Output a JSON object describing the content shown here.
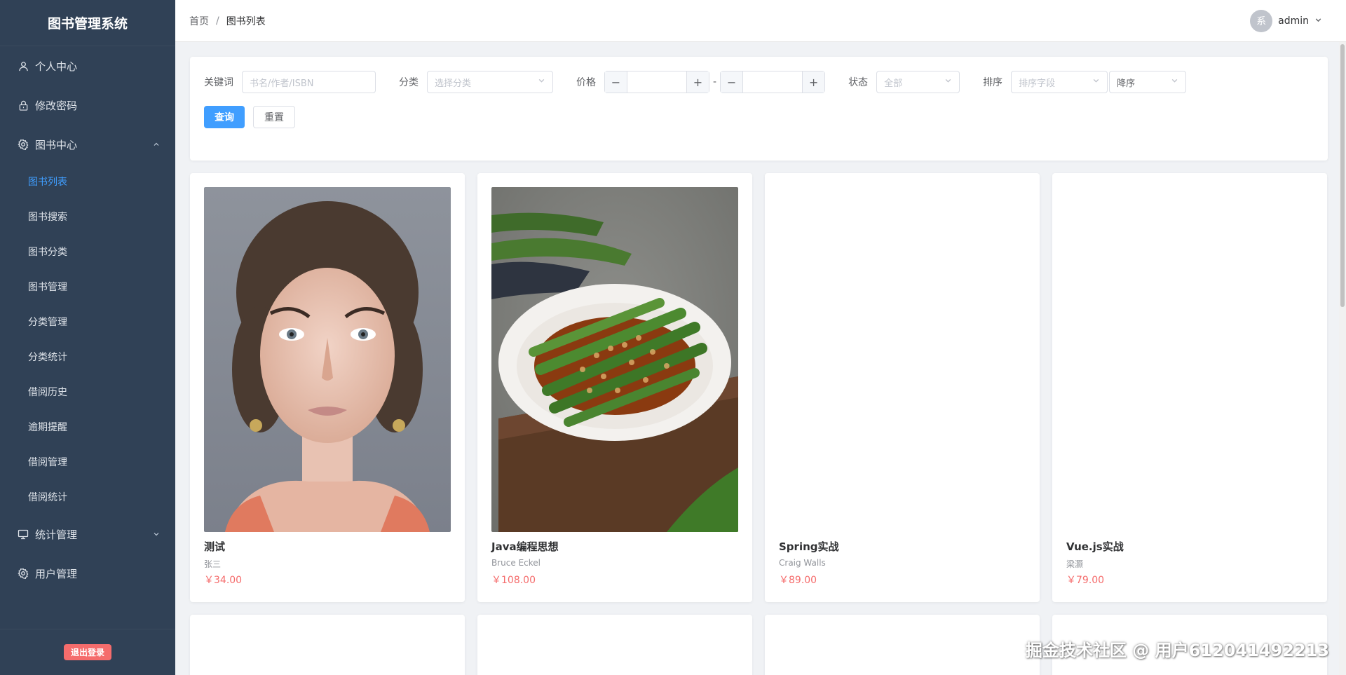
{
  "app": {
    "title": "图书管理系统"
  },
  "sidebar": {
    "items": [
      {
        "label": "个人中心",
        "icon": "user-icon"
      },
      {
        "label": "修改密码",
        "icon": "lock-icon"
      },
      {
        "label": "图书中心",
        "icon": "gear-icon",
        "expanded": true,
        "children": [
          "图书列表",
          "图书搜索",
          "图书分类",
          "图书管理",
          "分类管理",
          "分类统计",
          "借阅历史",
          "逾期提醒",
          "借阅管理",
          "借阅统计"
        ]
      },
      {
        "label": "统计管理",
        "icon": "monitor-icon",
        "expanded": false
      },
      {
        "label": "用户管理",
        "icon": "gear-icon"
      }
    ],
    "active_child": "图书列表",
    "logout_label": "退出登录"
  },
  "header": {
    "breadcrumb": [
      "首页",
      "图书列表"
    ],
    "avatar_text": "系",
    "username": "admin"
  },
  "filters": {
    "keyword_label": "关键词",
    "keyword_placeholder": "书名/作者/ISBN",
    "category_label": "分类",
    "category_placeholder": "选择分类",
    "price_label": "价格",
    "price_separator": "-",
    "status_label": "状态",
    "status_value": "全部",
    "sort_label": "排序",
    "sort_field_placeholder": "排序字段",
    "sort_order_value": "降序",
    "search_button": "查询",
    "reset_button": "重置"
  },
  "books": [
    {
      "title": "测试",
      "author": "张三",
      "price": "￥34.00",
      "cover": "portrait-photo"
    },
    {
      "title": "Java编程思想",
      "author": "Bruce Eckel",
      "price": "￥108.00",
      "cover": "okra-dish-photo"
    },
    {
      "title": "Spring实战",
      "author": "Craig Walls",
      "price": "￥89.00",
      "cover": "blank"
    },
    {
      "title": "Vue.js实战",
      "author": "梁灏",
      "price": "￥79.00",
      "cover": "blank"
    }
  ],
  "watermark": "掘金技术社区 @ 用户612041492213",
  "colors": {
    "sidebar_bg": "#304156",
    "accent": "#409eff",
    "price": "#f56c6c",
    "logout": "#f56c6c"
  }
}
